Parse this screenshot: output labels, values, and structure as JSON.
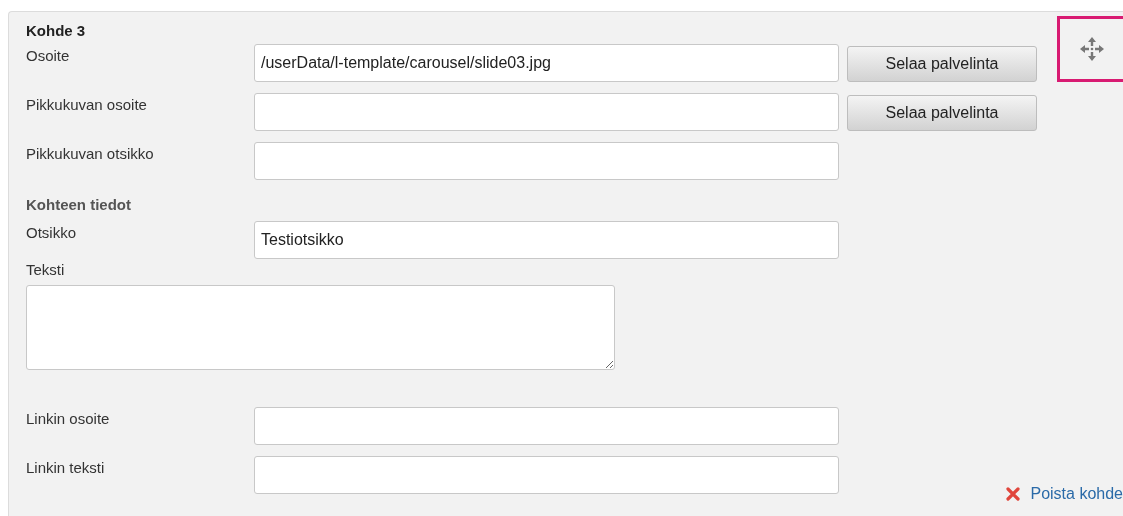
{
  "heading": "Kohde 3",
  "rows": [
    {
      "kind": "field",
      "label": "Osoite",
      "value": "/userData/l-template/carousel/slide03.jpg",
      "button": "Selaa palvelinta"
    },
    {
      "kind": "field",
      "label": "Pikkukuvan osoite",
      "button": "Selaa palvelinta"
    },
    {
      "kind": "field",
      "label": "Pikkukuvan otsikko"
    },
    {
      "kind": "subheading",
      "label": "Kohteen tiedot"
    },
    {
      "kind": "field",
      "label": "Otsikko",
      "value": "Testiotsikko"
    },
    {
      "kind": "textarea",
      "label": "Teksti"
    },
    {
      "kind": "field",
      "label": "Linkin osoite"
    },
    {
      "kind": "field",
      "label": "Linkin teksti"
    }
  ],
  "delete_link": "Poista kohde"
}
